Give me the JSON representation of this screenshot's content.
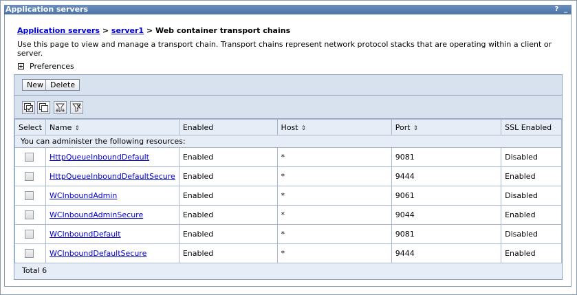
{
  "window": {
    "title": "Application servers",
    "help_label": "?",
    "min_label": "_"
  },
  "breadcrumb": {
    "link1": "Application servers",
    "sep1": " > ",
    "link2": "server1",
    "sep2": " > ",
    "current": "Web container transport chains"
  },
  "description": "Use this page to view and manage a transport chain. Transport chains represent network protocol stacks that are operating within a client or server.",
  "preferences_label": "Preferences",
  "toolbar": {
    "new_label": "New",
    "delete_label": "Delete"
  },
  "icons": [
    "select-all-icon",
    "deselect-all-icon",
    "show-filter-icon",
    "clear-filter-icon"
  ],
  "table": {
    "headers": {
      "select": "Select",
      "name": "Name",
      "enabled": "Enabled",
      "host": "Host",
      "port": "Port",
      "ssl": "SSL Enabled"
    },
    "info": "You can administer the following resources:",
    "rows": [
      {
        "name": "HttpQueueInboundDefault",
        "enabled": "Enabled",
        "host": "*",
        "port": "9081",
        "ssl": "Disabled"
      },
      {
        "name": "HttpQueueInboundDefaultSecure",
        "enabled": "Enabled",
        "host": "*",
        "port": "9444",
        "ssl": "Enabled"
      },
      {
        "name": "WCInboundAdmin",
        "enabled": "Enabled",
        "host": "*",
        "port": "9061",
        "ssl": "Disabled"
      },
      {
        "name": "WCInboundAdminSecure",
        "enabled": "Enabled",
        "host": "*",
        "port": "9044",
        "ssl": "Enabled"
      },
      {
        "name": "WCInboundDefault",
        "enabled": "Enabled",
        "host": "*",
        "port": "9081",
        "ssl": "Disabled"
      },
      {
        "name": "WCInboundDefaultSecure",
        "enabled": "Enabled",
        "host": "*",
        "port": "9444",
        "ssl": "Enabled"
      }
    ],
    "total": "Total 6"
  },
  "colors": {
    "titlebar": "#4d73a8",
    "link": "#0000cc",
    "header_bg": "#e6edf6",
    "bar_bg": "#d8e2ef"
  }
}
